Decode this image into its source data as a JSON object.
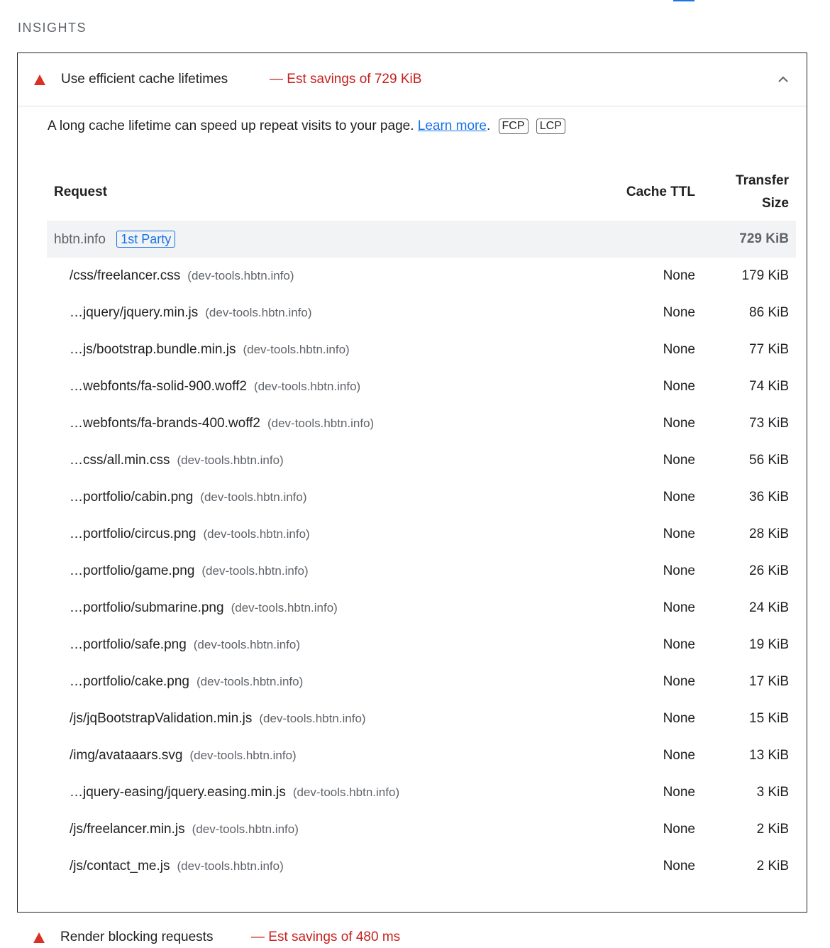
{
  "section_title": "INSIGHTS",
  "audit": {
    "title": "Use efficient cache lifetimes",
    "savings": "— Est savings of 729 KiB",
    "description": "A long cache lifetime can speed up repeat visits to your page.",
    "learn_more": "Learn more",
    "metrics": [
      "FCP",
      "LCP"
    ]
  },
  "table": {
    "headers": {
      "request": "Request",
      "cache_ttl": "Cache TTL",
      "transfer_size": "Transfer Size"
    },
    "group": {
      "entity": "hbtn.info",
      "badge": "1st Party",
      "size": "729 KiB"
    },
    "rows": [
      {
        "path": "/css/freelancer.css",
        "host": "(dev-tools.hbtn.info)",
        "ttl": "None",
        "size": "179 KiB"
      },
      {
        "path": "…jquery/jquery.min.js",
        "host": "(dev-tools.hbtn.info)",
        "ttl": "None",
        "size": "86 KiB"
      },
      {
        "path": "…js/bootstrap.bundle.min.js",
        "host": "(dev-tools.hbtn.info)",
        "ttl": "None",
        "size": "77 KiB"
      },
      {
        "path": "…webfonts/fa-solid-900.woff2",
        "host": "(dev-tools.hbtn.info)",
        "ttl": "None",
        "size": "74 KiB"
      },
      {
        "path": "…webfonts/fa-brands-400.woff2",
        "host": "(dev-tools.hbtn.info)",
        "ttl": "None",
        "size": "73 KiB"
      },
      {
        "path": "…css/all.min.css",
        "host": "(dev-tools.hbtn.info)",
        "ttl": "None",
        "size": "56 KiB"
      },
      {
        "path": "…portfolio/cabin.png",
        "host": "(dev-tools.hbtn.info)",
        "ttl": "None",
        "size": "36 KiB"
      },
      {
        "path": "…portfolio/circus.png",
        "host": "(dev-tools.hbtn.info)",
        "ttl": "None",
        "size": "28 KiB"
      },
      {
        "path": "…portfolio/game.png",
        "host": "(dev-tools.hbtn.info)",
        "ttl": "None",
        "size": "26 KiB"
      },
      {
        "path": "…portfolio/submarine.png",
        "host": "(dev-tools.hbtn.info)",
        "ttl": "None",
        "size": "24 KiB"
      },
      {
        "path": "…portfolio/safe.png",
        "host": "(dev-tools.hbtn.info)",
        "ttl": "None",
        "size": "19 KiB"
      },
      {
        "path": "…portfolio/cake.png",
        "host": "(dev-tools.hbtn.info)",
        "ttl": "None",
        "size": "17 KiB"
      },
      {
        "path": "/js/jqBootstrapValidation.min.js",
        "host": "(dev-tools.hbtn.info)",
        "ttl": "None",
        "size": "15 KiB"
      },
      {
        "path": "/img/avataaars.svg",
        "host": "(dev-tools.hbtn.info)",
        "ttl": "None",
        "size": "13 KiB"
      },
      {
        "path": "…jquery-easing/jquery.easing.min.js",
        "host": "(dev-tools.hbtn.info)",
        "ttl": "None",
        "size": "3 KiB"
      },
      {
        "path": "/js/freelancer.min.js",
        "host": "(dev-tools.hbtn.info)",
        "ttl": "None",
        "size": "2 KiB"
      },
      {
        "path": "/js/contact_me.js",
        "host": "(dev-tools.hbtn.info)",
        "ttl": "None",
        "size": "2 KiB"
      }
    ]
  },
  "next_audit": {
    "title": "Render blocking requests",
    "savings": "— Est savings of 480 ms"
  },
  "colors": {
    "warning": "#d93025",
    "savings": "#c5221f",
    "link": "#1a73e8",
    "group_bg": "#f1f3f4"
  },
  "icons": {
    "warning": "warning-triangle-icon",
    "collapse": "chevron-up-icon"
  }
}
